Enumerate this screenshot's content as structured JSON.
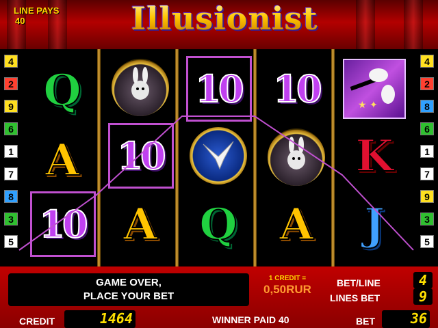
{
  "header": {
    "line_pays_label": "LINE PAYS",
    "line_pays_value": "40",
    "logo": "Illusionist"
  },
  "colors": {
    "payline_frame": "#c050d0",
    "panel_red": "#c00000",
    "digit_yellow": "#ffe000"
  },
  "reels": [
    [
      "Q",
      "rabbit-hat",
      "10"
    ],
    [
      "10",
      "10",
      "A"
    ],
    [
      "10",
      "dove",
      "Q"
    ],
    [
      "10",
      "rabbit-hat",
      "A"
    ],
    [
      "magic-wand",
      "K",
      "J"
    ]
  ],
  "reel_columns": [
    {
      "top": "Q",
      "bottom": "10"
    },
    {
      "middle": "10",
      "bottom": "A"
    },
    {
      "top": "10",
      "bottom": "Q"
    },
    {
      "top": "10",
      "bottom": "A"
    },
    {
      "middle": "K",
      "bottom": "J"
    }
  ],
  "left_lines": [
    "4",
    "2",
    "9",
    "6",
    "1",
    "7",
    "8",
    "3",
    "5"
  ],
  "right_lines": [
    "4",
    "2",
    "8",
    "6",
    "1",
    "7",
    "9",
    "3",
    "5"
  ],
  "line_colors": {
    "1": "#ffffff",
    "2": "#ff4030",
    "3": "#30c030",
    "4": "#ffe020",
    "5": "#ffffff",
    "6": "#30c030",
    "7": "#ffffff",
    "8": "#30a0ff",
    "9": "#ffe020"
  },
  "panel": {
    "message_line1": "GAME OVER,",
    "message_line2": "PLACE YOUR BET",
    "credit_rate_label": "1 CREDIT =",
    "credit_rate_value": "0,50RUR",
    "bet_line_label": "BET/LINE",
    "bet_line_value": "4",
    "lines_bet_label": "LINES BET",
    "lines_bet_value": "9",
    "credit_label": "CREDIT",
    "credit_value": "1464",
    "winner_paid_label": "WINNER PAID",
    "winner_paid_value": "40",
    "bet_label": "BET",
    "bet_value": "36"
  }
}
